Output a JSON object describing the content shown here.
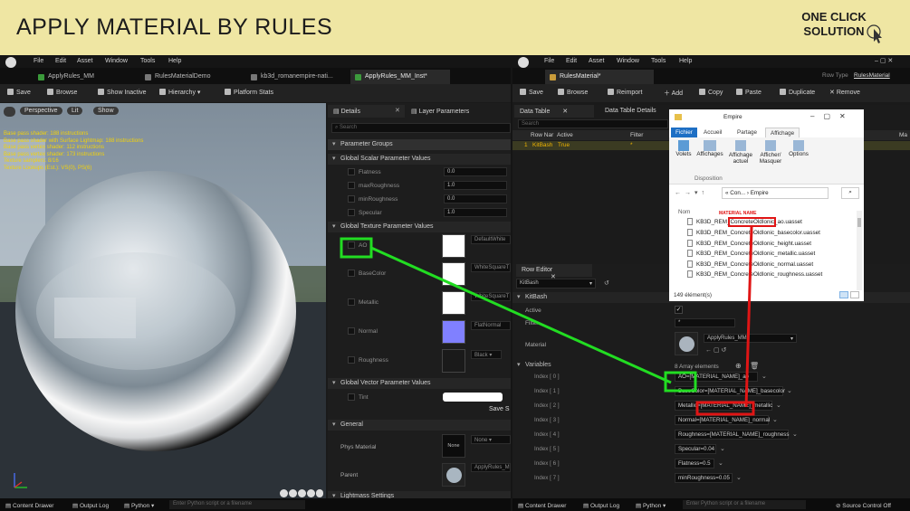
{
  "banner": {
    "title": "APPLY MATERIAL BY RULES",
    "subtitle_line1": "ONE CLICK",
    "subtitle_line2": "SOLUTION"
  },
  "left_window": {
    "menu": [
      "File",
      "Edit",
      "Asset",
      "Window",
      "Tools",
      "Help"
    ],
    "tabs": [
      "ApplyRules_MM",
      "RulesMaterialDemo",
      "kb3d_romanempire-nati...",
      "ApplyRules_MM_Inst*"
    ],
    "toolbar": {
      "save": "Save",
      "browse": "Browse",
      "show_inactive": "Show Inactive",
      "hierarchy": "Hierarchy",
      "platform_stats": "Platform Stats"
    },
    "viewport": {
      "perspective": "Perspective",
      "lit": "Lit",
      "show": "Show",
      "stats": [
        "Base pass shader: 188 instructions",
        "Base pass shader with Surface Lightmap: 188 instructions",
        "Base pass vertex shader: 112 instructions",
        "Base pass vertex shader: 173 instructions",
        "Texture samplers: 8/16",
        "Texture Lookups (Est.): VS(0), PS(6)"
      ]
    },
    "details": {
      "tab_details": "Details",
      "tab_layer": "Layer Parameters",
      "search": "Search",
      "param_groups": "Parameter Groups",
      "scalar_header": "Global Scalar Parameter Values",
      "scalars": [
        {
          "name": "Flatness",
          "value": "0.0"
        },
        {
          "name": "maxRoughness",
          "value": "1.0"
        },
        {
          "name": "minRoughness",
          "value": "0.0"
        },
        {
          "name": "Specular",
          "value": "1.0"
        }
      ],
      "texture_header": "Global Texture Parameter Values",
      "textures": [
        {
          "name": "AO",
          "value": "DefaultWhite",
          "color": "#ffffff"
        },
        {
          "name": "BaseColor",
          "value": "WhiteSquareT",
          "color": "#ffffff"
        },
        {
          "name": "Metallic",
          "value": "WhiteSquareT",
          "color": "#ffffff"
        },
        {
          "name": "Normal",
          "value": "FlatNormal",
          "color": "#8080ff"
        },
        {
          "name": "Roughness",
          "value": "Black",
          "color": "#1a1a1a"
        }
      ],
      "vector_header": "Global Vector Parameter Values",
      "vector": {
        "name": "Tint",
        "color": "#ffffff"
      },
      "save_label": "Save S",
      "general_header": "General",
      "phys_material": "Phys Material",
      "phys_value": "None",
      "none_thumb": "None",
      "parent": "Parent",
      "parent_value": "ApplyRules_M",
      "lightmass": "Lightmass Settings"
    },
    "status": {
      "content_drawer": "Content Drawer",
      "output_log": "Output Log",
      "python": "Python",
      "cmd_placeholder": "Enter Python script or a filename"
    }
  },
  "right_window": {
    "menu": [
      "File",
      "Edit",
      "Asset",
      "Window",
      "Tools",
      "Help"
    ],
    "tab": "RulesMaterial*",
    "row_type_label": "Row Type",
    "row_type_value": "RulesMaterial",
    "toolbar": {
      "save": "Save",
      "browse": "Browse",
      "reimport": "Reimport",
      "add": "Add",
      "copy": "Copy",
      "paste": "Paste",
      "duplicate": "Duplicate",
      "remove": "Remove"
    },
    "data_table_tab": "Data Table",
    "data_table_details_tab": "Data Table Details",
    "search": "Search",
    "columns": [
      "Row Nar",
      "Active",
      "Filter",
      "Ma"
    ],
    "row": {
      "index": "1",
      "name": "KitBash",
      "active": "True",
      "filter": "*"
    },
    "row_editor": {
      "title": "Row Editor",
      "row": "KitBash",
      "section": "KitBash",
      "active": "Active",
      "filter": "Filter",
      "filter_value": "*",
      "material": "Material",
      "material_value": "ApplyRules_MM",
      "variables": "Variables",
      "array_count": "8 Array elements",
      "items": [
        {
          "index": "Index [ 0 ]",
          "value": "AO=[MATERIAL_NAME]_ao"
        },
        {
          "index": "Index [ 1 ]",
          "value": "BaseColor=[MATERIAL_NAME]_basecolor"
        },
        {
          "index": "Index [ 2 ]",
          "value": "Metallic=[MATERIAL_NAME]_metallic"
        },
        {
          "index": "Index [ 3 ]",
          "value": "Normal=[MATERIAL_NAME]_normal"
        },
        {
          "index": "Index [ 4 ]",
          "value": "Roughness=[MATERIAL_NAME]_roughness"
        },
        {
          "index": "Index [ 5 ]",
          "value": "Specular=0.04"
        },
        {
          "index": "Index [ 6 ]",
          "value": "Flatness=0.5"
        },
        {
          "index": "Index [ 7 ]",
          "value": "minRoughness=0.05"
        }
      ]
    },
    "status": {
      "content_drawer": "Content Drawer",
      "output_log": "Output Log",
      "python": "Python",
      "cmd_placeholder": "Enter Python script or a filename",
      "source_control": "Source Control Off"
    }
  },
  "explorer": {
    "title": "Empire",
    "ribbon_tabs": [
      "Fichier",
      "Accueil",
      "Partage",
      "Affichage"
    ],
    "ribbon_buttons": [
      "Volets",
      "Affichages",
      "Affichage actuel",
      "Afficher/ Masquer",
      "Options"
    ],
    "ribbon_group": "Disposition",
    "path": [
      "Con...",
      "Empire"
    ],
    "column": "Nom",
    "annotation": "MATERIAL NAME",
    "highlight_name": "ConcreteOldIonic",
    "files": [
      "KB3D_REM_ConcreteOldIonic_ao.uasset",
      "KB3D_REM_ConcreteOldIonic_basecolor.uasset",
      "KB3D_REM_ConcreteOldIonic_height.uasset",
      "KB3D_REM_ConcreteOldIonic_metallic.uasset",
      "KB3D_REM_ConcreteOldIonic_normal.uasset",
      "KB3D_REM_ConcreteOldIonic_roughness.uasset"
    ],
    "count": "149 élément(s)"
  },
  "colors": {
    "banner": "#efe6a3",
    "highlight_green": "#22dd22",
    "highlight_red": "#e01515",
    "accent": "#1e8fd6"
  }
}
